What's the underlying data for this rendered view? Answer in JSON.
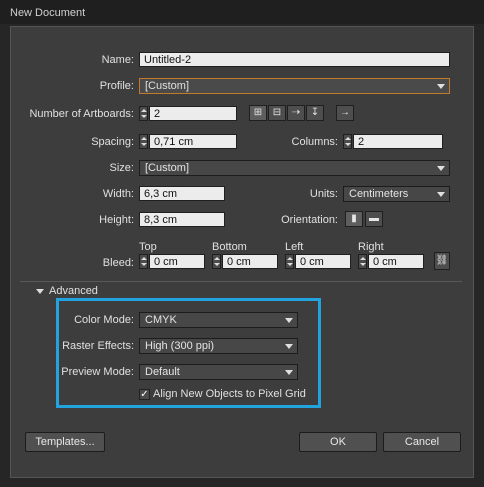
{
  "window": {
    "title": "New Document"
  },
  "form": {
    "name_label": "Name:",
    "name_value": "Untitled-2",
    "profile_label": "Profile:",
    "profile_value": "[Custom]",
    "artboards_label": "Number of Artboards:",
    "artboards_value": "2",
    "spacing_label": "Spacing:",
    "spacing_value": "0,71 cm",
    "columns_label": "Columns:",
    "columns_value": "2",
    "size_label": "Size:",
    "size_value": "[Custom]",
    "width_label": "Width:",
    "width_value": "6,3 cm",
    "units_label": "Units:",
    "units_value": "Centimeters",
    "height_label": "Height:",
    "height_value": "8,3 cm",
    "orientation_label": "Orientation:",
    "bleed_label": "Bleed:",
    "bleed": {
      "top_label": "Top",
      "top_value": "0 cm",
      "bottom_label": "Bottom",
      "bottom_value": "0 cm",
      "left_label": "Left",
      "left_value": "0 cm",
      "right_label": "Right",
      "right_value": "0 cm"
    }
  },
  "advanced": {
    "header": "Advanced",
    "color_mode_label": "Color Mode:",
    "color_mode_value": "CMYK",
    "raster_label": "Raster Effects:",
    "raster_value": "High (300 ppi)",
    "preview_label": "Preview Mode:",
    "preview_value": "Default",
    "align_label": "Align New Objects to Pixel Grid",
    "align_checked": true
  },
  "buttons": {
    "templates": "Templates...",
    "ok": "OK",
    "cancel": "Cancel"
  },
  "icons": {
    "artboard_layout": [
      "grid-by-row-icon",
      "grid-by-column-icon",
      "arrange-by-row-icon",
      "arrange-by-column-icon",
      "right-to-left-icon"
    ],
    "orientation": [
      "portrait-icon",
      "landscape-icon"
    ],
    "bleed_link": "link-icon"
  },
  "colors": {
    "highlight": "#23a3dd",
    "profile_border": "#c17a2c"
  }
}
